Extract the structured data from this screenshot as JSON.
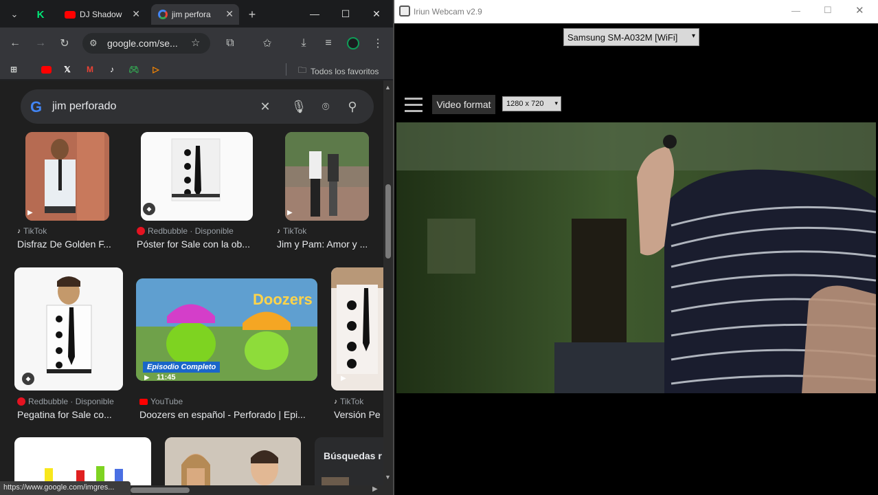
{
  "browser": {
    "tabs": [
      {
        "title": "DJ Shadow",
        "icon": "youtube-icon"
      },
      {
        "title": "jim perfora",
        "icon": "google-icon"
      }
    ],
    "new_tab": "+",
    "window_controls": {
      "minimize": "—",
      "maximize": "☐",
      "close": "✕"
    },
    "toolbar": {
      "url": "google.com/se..."
    },
    "bookmarks": {
      "all_label": "Todos los favoritos"
    },
    "status_url": "https://www.google.com/imgres..."
  },
  "search": {
    "query": "jim perforado"
  },
  "results": {
    "row1": [
      {
        "source": "TikTok",
        "title": "Disfraz De Golden F..."
      },
      {
        "source": "Redbubble · Disponible",
        "title": "Póster for Sale con la ob..."
      },
      {
        "source": "TikTok",
        "title": "Jim y Pam: Amor y ..."
      }
    ],
    "row2": [
      {
        "source": "Redbubble · Disponible",
        "title": "Pegatina for Sale co..."
      },
      {
        "source": "YouTube",
        "title": "Doozers en español - Perforado | Epi...",
        "badge": "Episodio Completo",
        "duration": "11:45"
      },
      {
        "source": "TikTok",
        "title": "Versión Pe"
      }
    ],
    "row3_heading": "Búsquedas r"
  },
  "webcam": {
    "title": "Iriun Webcam v2.9",
    "device": "Samsung SM-A032M [WiFi]",
    "video_format_label": "Video format",
    "video_format_value": "1280 x 720"
  },
  "colors": {
    "youtube_red": "#ff0000",
    "google_blue": "#4285f4",
    "chrome_dark": "#202124",
    "webcam_bg": "#000000",
    "wall_green": "#3f5a2e"
  }
}
